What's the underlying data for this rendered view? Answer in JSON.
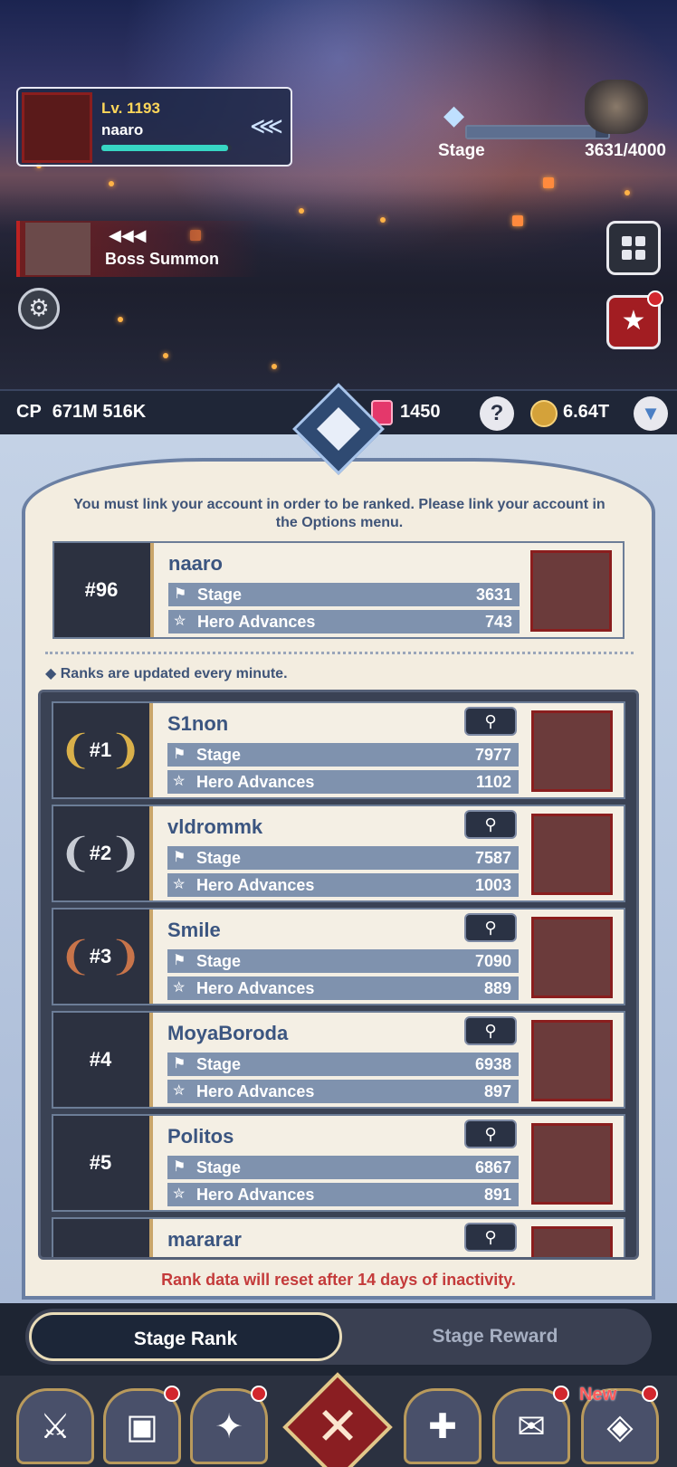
{
  "player": {
    "level": "Lv. 1193",
    "name": "naaro",
    "xp_fraction": 0.97
  },
  "stage_progress": {
    "label": "Stage",
    "count": "3631/4000",
    "fraction": 0.9078
  },
  "boss_summon": {
    "arrows": "◀◀◀",
    "label": "Boss Summon"
  },
  "resources": {
    "cp_label": "CP",
    "cp_value": "671M 516K",
    "gems": "1450",
    "help": "?",
    "gold": "6.64T"
  },
  "panel": {
    "notice": "You must link your account in order to be ranked. Please link your account in the Options menu.",
    "updated_note": "◆ Ranks are updated every minute.",
    "reset_note": "Rank data will reset after 14 days of inactivity.",
    "stage_label": "Stage",
    "advances_label": "Hero Advances"
  },
  "my_rank": {
    "rank": "#96",
    "name": "naaro",
    "stage": "3631",
    "advances": "743"
  },
  "rankings": [
    {
      "rank": "#1",
      "name": "S1non",
      "stage": "7977",
      "advances": "1102",
      "laurel_color": "#d9b04a"
    },
    {
      "rank": "#2",
      "name": "vldrommk",
      "stage": "7587",
      "advances": "1003",
      "laurel_color": "#c8ccd4"
    },
    {
      "rank": "#3",
      "name": "Smile",
      "stage": "7090",
      "advances": "889",
      "laurel_color": "#c8744a"
    },
    {
      "rank": "#4",
      "name": "MoyaBoroda",
      "stage": "6938",
      "advances": "897",
      "laurel_color": ""
    },
    {
      "rank": "#5",
      "name": "Politos",
      "stage": "6867",
      "advances": "891",
      "laurel_color": ""
    },
    {
      "rank": "",
      "name": "mararar",
      "stage": "",
      "advances": "",
      "laurel_color": ""
    }
  ],
  "tabs": [
    {
      "label": "Stage Rank",
      "active": true
    },
    {
      "label": "Stage Reward",
      "active": false
    }
  ],
  "bottom_nav": {
    "new_badge": "New",
    "items": [
      "hero-knight-icon",
      "treasure-chest-icon",
      "spellbook-icon",
      "close-icon",
      "guild-shield-icon",
      "scroll-letter-icon",
      "gem-shop-icon"
    ]
  },
  "colors": {
    "accent_red": "#c43b3b",
    "rank_bar": "#7f92ae",
    "name_blue": "#3b5580"
  }
}
